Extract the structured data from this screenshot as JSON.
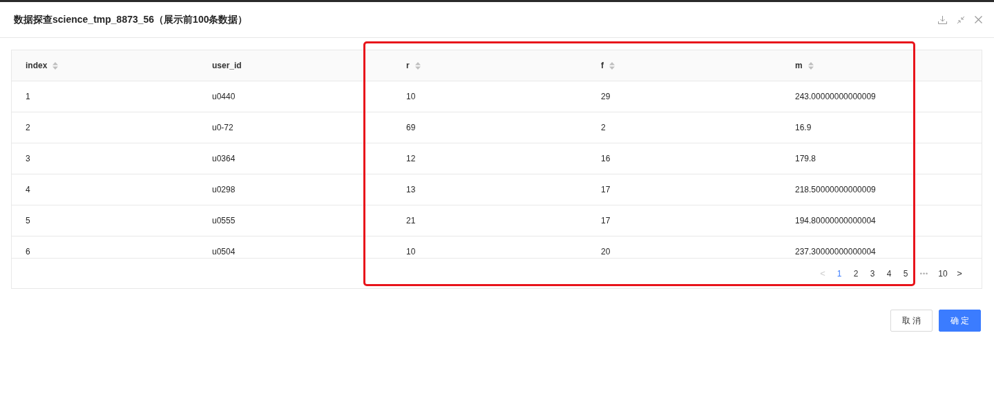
{
  "dialog": {
    "title": "数据探查science_tmp_8873_56（展示前100条数据）"
  },
  "table": {
    "columns": [
      {
        "label": "index",
        "sortable": true
      },
      {
        "label": "user_id",
        "sortable": false
      },
      {
        "label": "r",
        "sortable": true
      },
      {
        "label": "f",
        "sortable": true
      },
      {
        "label": "m",
        "sortable": true
      }
    ],
    "rows": [
      [
        "1",
        "u0440",
        "10",
        "29",
        "243.00000000000009"
      ],
      [
        "2",
        "u0-72",
        "69",
        "2",
        "16.9"
      ],
      [
        "3",
        "u0364",
        "12",
        "16",
        "179.8"
      ],
      [
        "4",
        "u0298",
        "13",
        "17",
        "218.50000000000009"
      ],
      [
        "5",
        "u0555",
        "21",
        "17",
        "194.80000000000004"
      ],
      [
        "6",
        "u0504",
        "10",
        "20",
        "237.30000000000004"
      ]
    ]
  },
  "pagination": {
    "prev": "<",
    "prev_disabled": true,
    "pages": [
      {
        "label": "1",
        "selected": true
      },
      {
        "label": "2",
        "selected": false
      },
      {
        "label": "3",
        "selected": false
      },
      {
        "label": "4",
        "selected": false
      },
      {
        "label": "5",
        "selected": false
      }
    ],
    "ellipsis": "•••",
    "last": {
      "label": "10",
      "selected": false
    },
    "next": ">",
    "next_disabled": false
  },
  "buttons": [
    {
      "label": "取 消",
      "kind": "default"
    },
    {
      "label": "确 定",
      "kind": "primary"
    }
  ]
}
